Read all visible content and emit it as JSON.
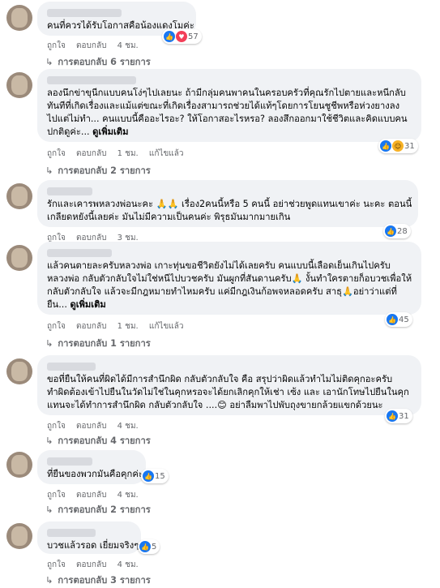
{
  "colors": {
    "accent": "#1877f2",
    "bubble": "#f0f2f5",
    "meta": "#65676b"
  },
  "comments": [
    {
      "text": "คนที่ควรได้รับโอกาสคือน้องแดงโมค่ะ",
      "see_more": "",
      "reactions": {
        "icons": [
          "like-icon",
          "love-icon"
        ],
        "count": "57"
      },
      "actions": {
        "like": "ถูกใจ",
        "reply": "ตอบกลับ",
        "time": "4 ชม.",
        "edited": ""
      },
      "replies": "การตอบกลับ 6 รายการ"
    },
    {
      "text": "ลองนึกข่าขุนีกแบบคนโง่ๆไปเลยนะ ถ้ามีกลุ่มคนพาคนในครอบครัวที่คุณรักไปตายและหนีกลับ\nทันทีที่เกิดเรื่องและแม้แต่ขณะที่เกิดเรื่องสามารถช่วยได้แท้ๆโดยการโยนชูชีพหรือห่วงยางลง\nไปแต่ไม่ทำ... คนแบบนี้คืออะไรอะ? ให้โอกาสอะไรหรอ? ลองสึกออกมาใช้ชีวิตและคิดแบบคน\nปกติดูค่ะ...",
      "see_more": "ดูเพิ่มเติม",
      "reactions": {
        "icons": [
          "like-icon",
          "haha-icon"
        ],
        "count": "31"
      },
      "actions": {
        "like": "ถูกใจ",
        "reply": "ตอบกลับ",
        "time": "1 ชม.",
        "edited": "แก้ไขแล้ว"
      },
      "replies": "การตอบกลับ 2 รายการ"
    },
    {
      "text": "รักและเคารพหลวงพ่อนะคะ 🙏🙏 เรื่อง2คนนี้หรือ 5 คนนี้ อย่าช่วยพูดแทนเขาค่ะ นะคะ ตอนนี้\nเกลียดหยังนี้เลยค่ะ มันไม่มีความเป็นคนค่ะ พิรุธมันมากมายเกิน",
      "see_more": "",
      "reactions": {
        "icons": [
          "like-icon"
        ],
        "count": "28"
      },
      "actions": {
        "like": "ถูกใจ",
        "reply": "ตอบกลับ",
        "time": "3 ชม.",
        "edited": ""
      },
      "replies": ""
    },
    {
      "text": "แล้วคนตายละครับหลวงพ่อ เกาะทุ่นขอชีวิตยังไม่ได้เลยครับ คนแบบนี้เลือดเย็นเกินไปครับ\nหลวงพ่อ กลับตัวกลับใจไม่ใช่หนีไปบวชครับ มันผูกที่สันดานครับ🙏 งั้นทำใครตายก็อบวชเพื่อให้\nกลับตัวกลับใจ แล้วจะมีกฎหมายทำไหมครับ แค่มีกฎเงินก้อพจหลอดครับ สาธุ🙏อย่าว่าแต่ที่\nยืน...",
      "see_more": "ดูเพิ่มเติม",
      "reactions": {
        "icons": [
          "like-icon"
        ],
        "count": "45"
      },
      "actions": {
        "like": "ถูกใจ",
        "reply": "ตอบกลับ",
        "time": "1 ชม.",
        "edited": "แก้ไขแล้ว"
      },
      "replies": "การตอบกลับ 1 รายการ"
    },
    {
      "text": "ขอที่ยืนให้คนที่ผิดได้มีการสำนึกผิด กลับตัวกลับใจ คือ สรุปว่าผิดแล้วทำไมไม่ติดคุกอะครับ\nทำผิดต้องเข้าไปยืนในวัดไม่ใช่ในคุกหรอจะได้ยกเลิกคุกให้เช่า เซ้ง และ เอานักโทษไปยืนในคุก\nแทนจะได้ทำการสำนึกผิด กลับตัวกลับใจ ....😊 อย่าลืมพาไปพับถุงขายกล้วยแขกด้วยนะ",
      "see_more": "",
      "reactions": {
        "icons": [
          "like-icon"
        ],
        "count": "31"
      },
      "actions": {
        "like": "ถูกใจ",
        "reply": "ตอบกลับ",
        "time": "4 ชม.",
        "edited": ""
      },
      "replies": "การตอบกลับ 4 รายการ"
    },
    {
      "text": "ที่ยืนของพวกมันคือคุกค่ะ",
      "see_more": "",
      "reactions": {
        "icons": [
          "like-icon"
        ],
        "count": "15"
      },
      "actions": {
        "like": "ถูกใจ",
        "reply": "ตอบกลับ",
        "time": "4 ชม.",
        "edited": ""
      },
      "replies": "การตอบกลับ 2 รายการ"
    },
    {
      "text": "บวชแล้วรอด เยี่ยมจริงๆ",
      "see_more": "",
      "reactions": {
        "icons": [
          "like-icon"
        ],
        "count": "5"
      },
      "actions": {
        "like": "ถูกใจ",
        "reply": "ตอบกลับ",
        "time": "4 ชม.",
        "edited": ""
      },
      "replies": "การตอบกลับ 3 รายการ"
    }
  ]
}
